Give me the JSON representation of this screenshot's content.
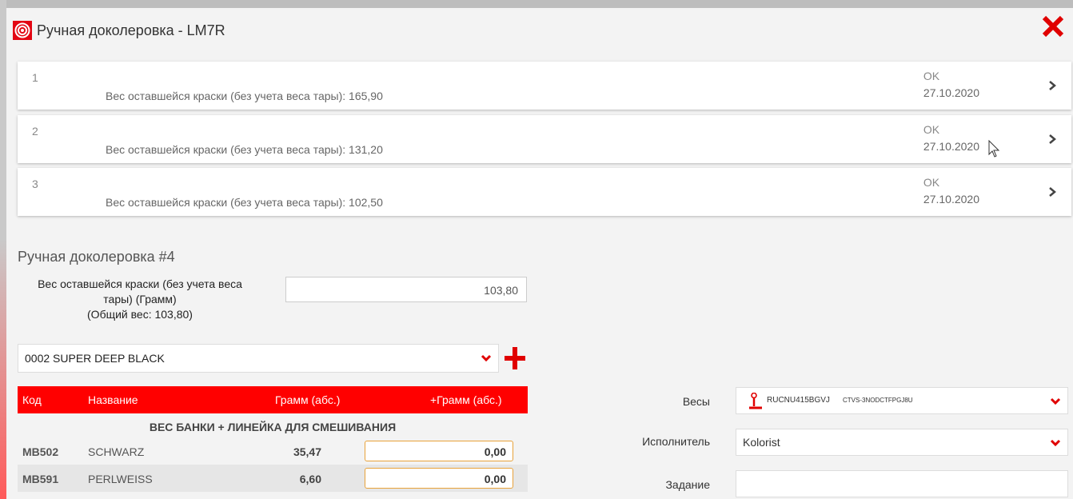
{
  "window": {
    "title": "Ручная доколеровка - LM7R"
  },
  "history": [
    {
      "num": "1",
      "text": "Вес оставшейся краски (без учета веса тары): 165,90",
      "status": "OK",
      "date": "27.10.2020"
    },
    {
      "num": "2",
      "text": "Вес оставшейся краски (без учета веса тары): 131,20",
      "status": "OK",
      "date": "27.10.2020"
    },
    {
      "num": "3",
      "text": "Вес оставшейся краски (без учета веса тары): 102,50",
      "status": "OK",
      "date": "27.10.2020"
    }
  ],
  "form": {
    "section_title": "Ручная доколеровка #4",
    "weight_label_1": "Вес оставшейся краски (без учета веса",
    "weight_label_2": "тары) (Грамм)",
    "weight_label_3": "(Общий вес: 103,80)",
    "weight_value": "103,80",
    "color_value": "0002 SUPER DEEP BLACK"
  },
  "table": {
    "headers": {
      "code": "Код",
      "name": "Название",
      "gram": "Грамм (абс.)",
      "plus": "+Грамм (абс.)"
    },
    "group": "ВЕС БАНКИ + ЛИНЕЙКА ДЛЯ СМЕШИВАНИЯ",
    "rows": [
      {
        "code": "MB502",
        "name": "SCHWARZ",
        "gram": "35,47",
        "plus": "0,00"
      },
      {
        "code": "MB591",
        "name": "PERLWEISS",
        "gram": "6,60",
        "plus": "0,00"
      }
    ]
  },
  "right": {
    "scale_label": "Весы",
    "scale_value_main": "RUCNU415BGVJ",
    "scale_value_sub": "CTVS-3NODCTFPGJ8U",
    "operator_label": "Исполнитель",
    "operator_value": "Kolorist",
    "task_label": "Задание",
    "task_value": ""
  },
  "colors": {
    "accent": "#ff0000",
    "brand": "#e30613",
    "input_border": "#e8a23a"
  }
}
